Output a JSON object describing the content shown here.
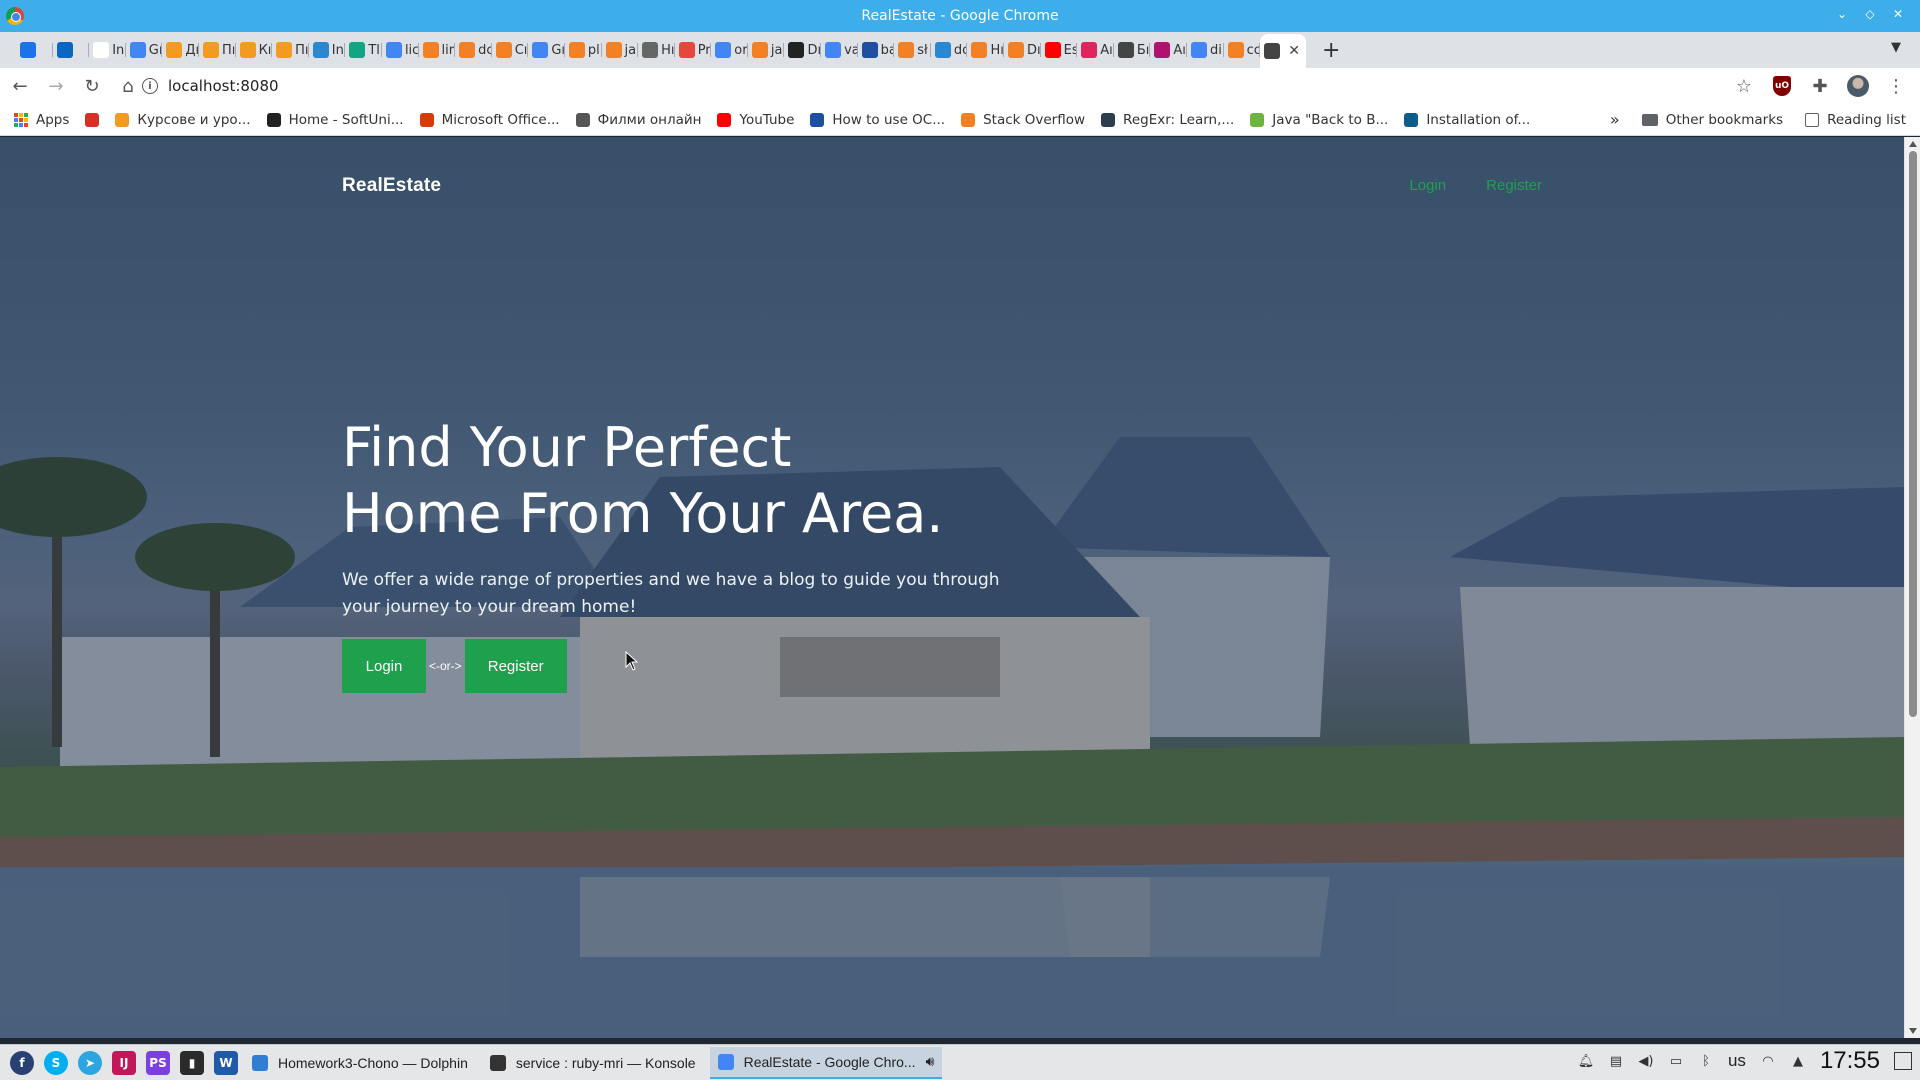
{
  "window": {
    "title": "RealEstate - Google Chrome"
  },
  "tabs": [
    {
      "label": "",
      "icon": "chat-icon",
      "color": "#1a73e8"
    },
    {
      "label": "",
      "icon": "linkedin-icon",
      "color": "#0a66c2"
    },
    {
      "label": "In",
      "icon": "wikipedia-icon",
      "color": "#ffffff"
    },
    {
      "label": "Gı",
      "icon": "google-translate-icon",
      "color": "#4285f4"
    },
    {
      "label": "Дı",
      "icon": "softuni-icon",
      "color": "#f29b20"
    },
    {
      "label": "Пı",
      "icon": "softuni-icon",
      "color": "#f29b20"
    },
    {
      "label": "Кı",
      "icon": "softuni-icon",
      "color": "#f29b20"
    },
    {
      "label": "Пı",
      "icon": "softuni-icon",
      "color": "#f29b20"
    },
    {
      "label": "In",
      "icon": "edge-icon",
      "color": "#2a87d0"
    },
    {
      "label": "Tl",
      "icon": "checkmark-icon",
      "color": "#11a683"
    },
    {
      "label": "lic",
      "icon": "google-icon",
      "color": "#4285f4"
    },
    {
      "label": "lir",
      "icon": "stackoverflow-icon",
      "color": "#f48024"
    },
    {
      "label": "dc",
      "icon": "stackoverflow-icon",
      "color": "#f48024"
    },
    {
      "label": "Cı",
      "icon": "stackoverflow-icon",
      "color": "#f48024"
    },
    {
      "label": "Gı",
      "icon": "google-icon",
      "color": "#4285f4"
    },
    {
      "label": "pl",
      "icon": "stackoverflow-icon",
      "color": "#f48024"
    },
    {
      "label": "ja",
      "icon": "stackoverflow-icon",
      "color": "#f48024"
    },
    {
      "label": "Hı",
      "icon": "road-icon",
      "color": "#666666"
    },
    {
      "label": "Pr",
      "icon": "prime-icon",
      "color": "#e8453c"
    },
    {
      "label": "or",
      "icon": "google-icon",
      "color": "#4285f4"
    },
    {
      "label": "ja",
      "icon": "stackoverflow-icon",
      "color": "#f48024"
    },
    {
      "label": "Dı",
      "icon": "medium-icon",
      "color": "#222222"
    },
    {
      "label": "va",
      "icon": "google-icon",
      "color": "#4285f4"
    },
    {
      "label": "ba",
      "icon": "u-icon",
      "color": "#1e4fa0"
    },
    {
      "label": "sł",
      "icon": "stackoverflow-icon",
      "color": "#f48024"
    },
    {
      "label": "dc",
      "icon": "edge-icon",
      "color": "#2a87d0"
    },
    {
      "label": "Hı",
      "icon": "stackoverflow-icon",
      "color": "#f48024"
    },
    {
      "label": "Dı",
      "icon": "stackoverflow-icon",
      "color": "#f48024"
    },
    {
      "label": "Es",
      "icon": "youtube-icon",
      "color": "#ff0000"
    },
    {
      "label": "Aı",
      "icon": "image-icon",
      "color": "#e0245e"
    },
    {
      "label": "Бı",
      "icon": "globe-icon",
      "color": "#444444"
    },
    {
      "label": "Aı",
      "icon": "v-icon",
      "color": "#b0126f"
    },
    {
      "label": "di",
      "icon": "google-icon",
      "color": "#4285f4"
    },
    {
      "label": "cc",
      "icon": "stackoverflow-icon",
      "color": "#f48024"
    },
    {
      "label": "",
      "icon": "globe-icon",
      "color": "#444444",
      "active": true
    }
  ],
  "toolbar": {
    "url": "localhost:8080"
  },
  "bookmarks": {
    "items": [
      {
        "label": "Apps",
        "icon": "apps-grid-icon",
        "color": "#d93025"
      },
      {
        "label": "",
        "icon": "gmail-icon",
        "color": "#d93025"
      },
      {
        "label": "Курсове и уро...",
        "icon": "softuni-icon",
        "color": "#f29b20"
      },
      {
        "label": "Home - SoftUni...",
        "icon": "softuni-dark-icon",
        "color": "#222222"
      },
      {
        "label": "Microsoft Office...",
        "icon": "office-icon",
        "color": "#d83b01"
      },
      {
        "label": "Филми онлайн",
        "icon": "film-icon",
        "color": "#555555"
      },
      {
        "label": "YouTube",
        "icon": "youtube-icon",
        "color": "#ff0000"
      },
      {
        "label": "How to use OC...",
        "icon": "u-icon",
        "color": "#1e4fa0"
      },
      {
        "label": "Stack Overflow",
        "icon": "stackoverflow-icon",
        "color": "#f48024"
      },
      {
        "label": "RegExr: Learn,...",
        "icon": "regexr-icon",
        "color": "#2c3e50"
      },
      {
        "label": "Java \"Back to B...",
        "icon": "leaf-icon",
        "color": "#6db33f"
      },
      {
        "label": "Installation of...",
        "icon": "doc-icon",
        "color": "#0b5e8a"
      }
    ],
    "more": "»",
    "other": "Other bookmarks",
    "reading": "Reading list"
  },
  "page": {
    "brand": "RealEstate",
    "nav": {
      "login": "Login",
      "register": "Register"
    },
    "hero": {
      "title_line1": "Find Your Perfect",
      "title_line2": "Home From Your Area.",
      "subtitle": "We offer a wide range of properties and we have a blog to guide you through your journey to your dream home!",
      "login_button": "Login",
      "separator": "<-or->",
      "register_button": "Register"
    },
    "accent": "#1fa04d"
  },
  "taskbar": {
    "tasks": [
      {
        "label": "Homework3-Chono — Dolphin",
        "icon": "folder-icon",
        "color": "#2e7fd3"
      },
      {
        "label": "service : ruby-mri — Konsole",
        "icon": "terminal-icon",
        "color": "#333333"
      },
      {
        "label": "RealEstate - Google Chro...",
        "icon": "chrome-icon",
        "color": "#4285f4",
        "active": true
      }
    ],
    "keyboard_layout": "us",
    "clock": "17:55"
  }
}
